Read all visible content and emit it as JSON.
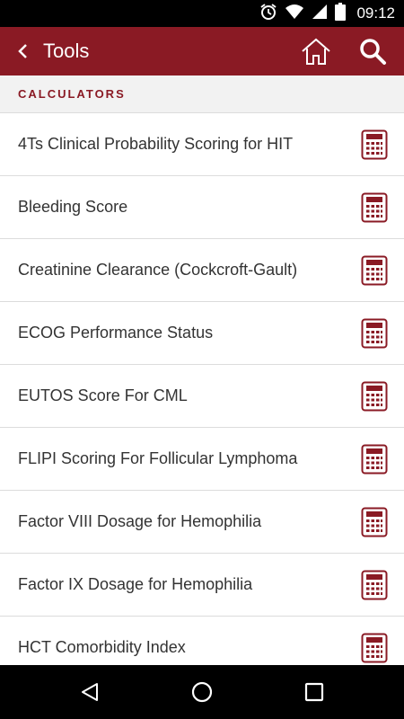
{
  "status_bar": {
    "time": "09:12",
    "icons": [
      "alarm-icon",
      "wifi-icon",
      "cell-signal-icon",
      "battery-icon"
    ]
  },
  "app_bar": {
    "title": "Tools",
    "back_icon": "chevron-left-icon",
    "home_icon": "home-icon",
    "search_icon": "search-icon"
  },
  "section": {
    "header": "CALCULATORS"
  },
  "calculators": [
    {
      "label": "4Ts Clinical Probability Scoring for HIT",
      "icon": "calculator-icon"
    },
    {
      "label": "Bleeding Score",
      "icon": "calculator-icon"
    },
    {
      "label": "Creatinine Clearance (Cockcroft-Gault)",
      "icon": "calculator-icon"
    },
    {
      "label": "ECOG Performance Status",
      "icon": "calculator-icon"
    },
    {
      "label": "EUTOS Score For CML",
      "icon": "calculator-icon"
    },
    {
      "label": "FLIPI Scoring For Follicular Lymphoma",
      "icon": "calculator-icon"
    },
    {
      "label": "Factor VIII Dosage for Hemophilia",
      "icon": "calculator-icon"
    },
    {
      "label": "Factor IX Dosage for Hemophilia",
      "icon": "calculator-icon"
    },
    {
      "label": "HCT Comorbidity Index",
      "icon": "calculator-icon"
    }
  ],
  "nav_bar": {
    "buttons": [
      "back-triangle-icon",
      "home-circle-icon",
      "recents-square-icon"
    ]
  },
  "colors": {
    "brand": "#8a1a24",
    "header_bg": "#f2f2f2",
    "text": "#333333"
  }
}
